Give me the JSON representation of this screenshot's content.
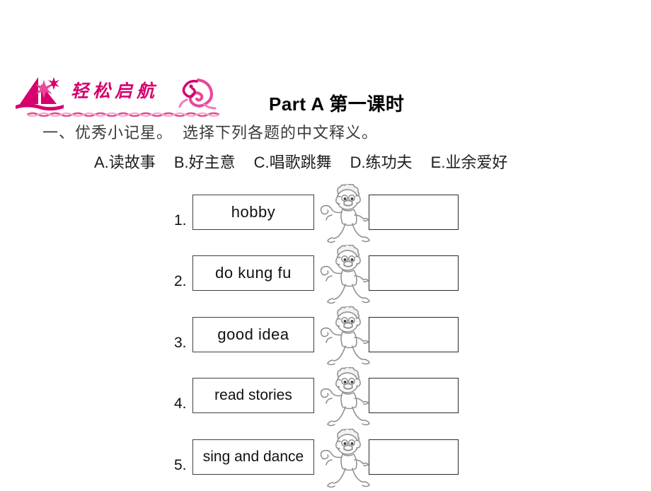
{
  "banner": {
    "logo_text": "轻松启航",
    "logo_color": "#d6006e",
    "boat_icon": "sailboat-icon",
    "flourish_icon": "phoenix-swirl-ornament-icon"
  },
  "header": {
    "part_label": "Part A",
    "lesson_label": "第一课时"
  },
  "instruction": {
    "section_number": "一、",
    "section_title": "优秀小记星。",
    "task_text": "选择下列各题的中文释义。"
  },
  "options": [
    {
      "letter": "A.",
      "text": "读故事"
    },
    {
      "letter": "B.",
      "text": "好主意"
    },
    {
      "letter": "C.",
      "text": "唱歌跳舞"
    },
    {
      "letter": "D.",
      "text": "练功夫"
    },
    {
      "letter": "E.",
      "text": "业余爱好"
    }
  ],
  "exercises": [
    {
      "number": "1.",
      "word": "hobby",
      "answer": ""
    },
    {
      "number": "2.",
      "word": "do kung fu",
      "answer": ""
    },
    {
      "number": "3.",
      "word": "good idea",
      "answer": ""
    },
    {
      "number": "4.",
      "word": "read stories",
      "answer": ""
    },
    {
      "number": "5.",
      "word": "sing and dance",
      "answer": ""
    }
  ],
  "colors": {
    "accent_pink": "#d6006e",
    "box_border": "#3f3f3f",
    "text": "#111111",
    "instruction_text": "#3a3a3a",
    "background": "#ffffff"
  }
}
